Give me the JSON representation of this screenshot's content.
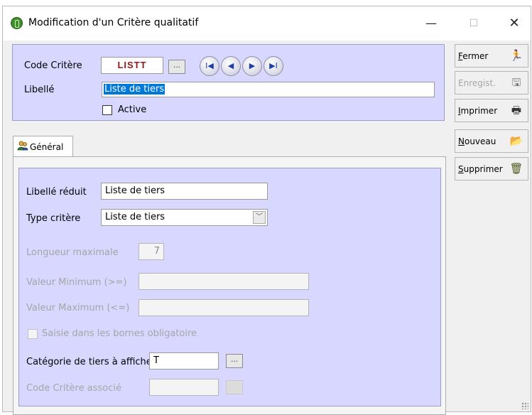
{
  "window": {
    "title": "Modification d'un Critère qualitatif",
    "minimize_glyph": "—",
    "maximize_glyph": "☐",
    "close_glyph": "✕"
  },
  "header": {
    "code_label": "Code Critère",
    "code_value": "LISTT",
    "browse_glyph": "...",
    "nav": {
      "first": "I◀",
      "prev": "◀",
      "next": "▶",
      "last": "▶I"
    },
    "libelle_label": "Libellé",
    "libelle_value": "Liste de tiers",
    "active_label": "Active",
    "active_checked": false
  },
  "tabs": [
    {
      "label": "Général",
      "icon": "users-tab-icon",
      "selected": true
    }
  ],
  "general": {
    "libelle_reduit_label": "Libellé réduit",
    "libelle_reduit_value": "Liste de tiers",
    "type_critere_label": "Type critère",
    "type_critere_value": "Liste de tiers",
    "longueur_label": "Longueur maximale",
    "longueur_value": "7",
    "val_min_label": "Valeur Minimum (>=)",
    "val_min_value": "",
    "val_max_label": "Valeur Maximum (<=)",
    "val_max_value": "",
    "saisie_label": "Saisie dans les bornes obligatoire",
    "categorie_label": "Catégorie de tiers à afficher",
    "categorie_value": "T",
    "code_associe_label": "Code Critère associé",
    "code_associe_value": ""
  },
  "actions": [
    {
      "underline": "F",
      "rest": "ermer",
      "icon": "exit-icon",
      "glyph": "🏃",
      "enabled": true
    },
    {
      "underline": "",
      "rest": "Enregist.",
      "icon": "save-icon",
      "glyph": "🖫",
      "enabled": false
    },
    {
      "underline": "I",
      "rest": "mprimer",
      "icon": "printer-icon",
      "glyph": "🖶",
      "enabled": true
    },
    {
      "underline": "N",
      "rest": "ouveau",
      "icon": "new-folder-icon",
      "glyph": "📂",
      "enabled": true
    },
    {
      "underline": "S",
      "rest": "upprimer",
      "icon": "trash-icon",
      "glyph": "🗑",
      "enabled": true
    }
  ],
  "colors": {
    "panel": "#d7d7ff",
    "code_text": "#8b1a1a",
    "selection": "#0078d7"
  }
}
